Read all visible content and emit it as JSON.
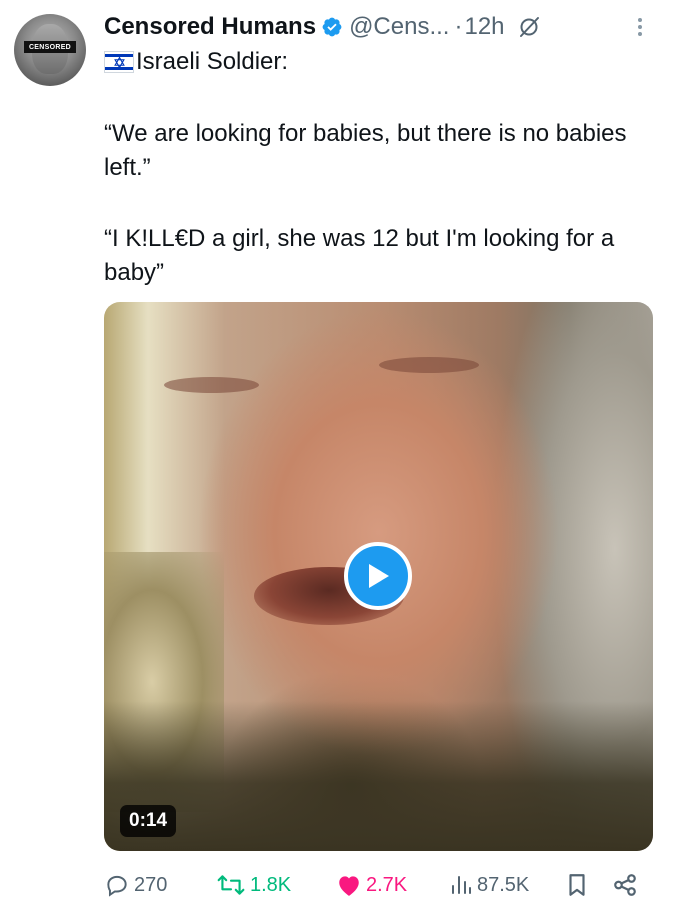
{
  "tweet": {
    "author_name": "Censored Humans",
    "handle": "@Cens...",
    "separator": "·",
    "time": "12h",
    "avatar_text": "CENSORED",
    "first_line": "Israeli Soldier:",
    "quote1": "“We are looking for babies, but there is no babies left.”",
    "quote2": "“I K!LL€D a girl, she was 12 but I'm looking for a baby”"
  },
  "media": {
    "type": "video",
    "duration": "0:14"
  },
  "actions": {
    "replies": "270",
    "retweets": "1.8K",
    "likes": "2.7K",
    "views": "87.5K"
  },
  "colors": {
    "verified": "#1d9bf0",
    "retweet_active": "#00ba7c",
    "like_active": "#f91880",
    "secondary_text": "#536471",
    "play_button": "#1d9bf0"
  },
  "icons": [
    "verified-badge-icon",
    "grok-icon",
    "more-icon",
    "israel-flag-icon",
    "play-icon",
    "reply-icon",
    "retweet-icon",
    "like-icon",
    "views-icon",
    "bookmark-icon",
    "share-icon"
  ]
}
